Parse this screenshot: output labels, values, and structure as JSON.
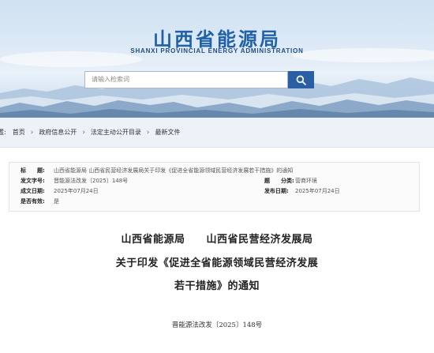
{
  "header": {
    "site_title": "山西省能源局",
    "site_subtitle": "SHANXI PROVINCIAL ENERGY ADMINISTRATION",
    "search": {
      "placeholder": "请输入检索词"
    },
    "search_button_icon": "search-icon",
    "colors": {
      "brand_blue": "#1f62a8",
      "search_button": "#2a5fa3"
    }
  },
  "breadcrumb": {
    "leading_fragment": "置:",
    "items": [
      "首页",
      "政府信息公开",
      "法定主动公开目录",
      "最新文件"
    ]
  },
  "meta": {
    "title_label": "标　　题:",
    "title_value": "山西省能源局 山西省民营经济发展局关于印发《促进全省能源领域民营经济发展若干措施》的通知",
    "doc_no_label": "发文字号:",
    "doc_no_value": "晋能源法改发〔2025〕148号",
    "category_label": "题　　分类:",
    "category_value": "营商环境",
    "created_label": "成文日期:",
    "created_value": "2025年07月24日",
    "published_label": "发布日期:",
    "published_value": "2025年07月24日",
    "valid_label": "是否有效:",
    "valid_value": "是"
  },
  "document": {
    "issuers": "山西省能源局　　山西省民营经济发展局",
    "title_line1": "关于印发《促进全省能源领域民营经济发展",
    "title_line2": "若干措施》的通知",
    "doc_number": "晋能源法改发〔2025〕148号"
  }
}
